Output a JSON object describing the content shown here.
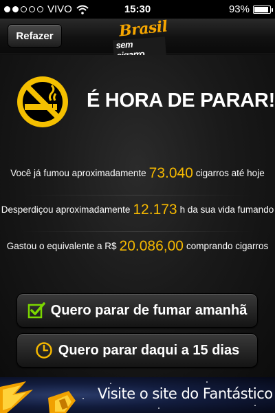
{
  "status": {
    "carrier": "VIVO",
    "time": "15:30",
    "battery": "93%",
    "battery_level": 0.93
  },
  "nav": {
    "refazer_label": "Refazer",
    "logo_top": "Brasil",
    "logo_bottom": "sem cigarro"
  },
  "headline": "É HORA DE PARAR!",
  "stats": [
    {
      "before": "Você já fumou aproximadamente",
      "value": "73.040",
      "after": "cigarros até hoje"
    },
    {
      "before": "Desperdiçou aproximadamente",
      "value": "12.173",
      "after": "h da sua vida fumando"
    },
    {
      "before": "Gastou o equivalente a R$",
      "value": "20.086,00",
      "after": "comprando cigarros"
    }
  ],
  "actions": {
    "tomorrow_label": "Quero parar de fumar amanhã",
    "fifteen_label": "Quero parar daqui a 15 dias"
  },
  "banner": {
    "text": "Visite o site do Fantástico"
  },
  "colors": {
    "accent": "#f5b800",
    "checkbox": "#7bd700",
    "clock_icon": "#f5b800"
  }
}
